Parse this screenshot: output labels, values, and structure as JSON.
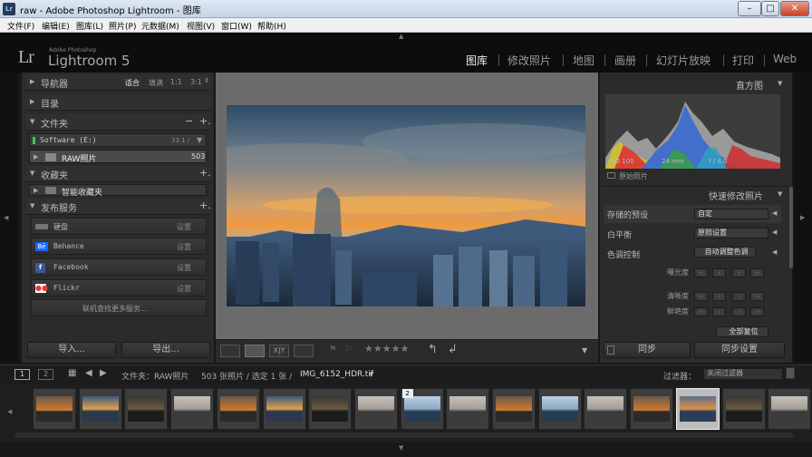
{
  "window": {
    "icon": "Lr",
    "title": "raw - Adobe Photoshop Lightroom - 图库",
    "minimize": "–",
    "maximize": "□",
    "close": "✕"
  },
  "menu": [
    "文件(F)",
    "编辑(E)",
    "图库(L)",
    "照片(P)",
    "元数据(M)",
    "视图(V)",
    "窗口(W)",
    "帮助(H)"
  ],
  "identity": {
    "logo": "Lr",
    "brand_small": "Adobe Photoshop",
    "brand": "Lightroom 5",
    "modules": [
      "图库",
      "修改照片",
      "地图",
      "画册",
      "幻灯片放映",
      "打印",
      "Web"
    ]
  },
  "left_panel": {
    "navigator": {
      "title": "导航器",
      "zoom": [
        "适合",
        "填满",
        "1:1",
        "3:1"
      ]
    },
    "catalog": {
      "title": "目录"
    },
    "folders": {
      "title": "文件夹",
      "volume": "Software (E:)",
      "volume_size": "33.1 / ",
      "folder": "RAW照片",
      "folder_count": "503"
    },
    "collections": {
      "title": "收藏夹",
      "smart": "智能收藏夹"
    },
    "publish": {
      "title": "发布服务",
      "items": [
        {
          "label": "硬盘",
          "setting": "设置"
        },
        {
          "label": "Behance",
          "icon": "Bē",
          "setting": "设置"
        },
        {
          "label": "Facebook",
          "icon": "f",
          "setting": "设置"
        },
        {
          "label": "Flickr",
          "icon": "●●",
          "setting": "设置"
        }
      ],
      "more": "联机查找更多服务..."
    },
    "import": "导入...",
    "export": "导出..."
  },
  "right_panel": {
    "histogram": {
      "title": "直方图",
      "iso": "ISO 100",
      "focal": "24 mm",
      "aperture": "f / 4.0",
      "original": "原始照片"
    },
    "quick_develop": {
      "title": "快速修改照片",
      "saved_preset_label": "存储的预设",
      "saved_preset_value": "自定",
      "wb_label": "白平衡",
      "wb_value": "原照设置",
      "tone_label": "色调控制",
      "auto_tone": "自动调整色调",
      "exposure": "曝光度",
      "clarity": "清晰度",
      "vibrance": "鲜艳度",
      "reset": "全部复位"
    },
    "sync": "同步",
    "sync_settings": "同步设置"
  },
  "toolbar": {
    "stars": "★★★★★"
  },
  "filmstrip_bar": {
    "page1": "1",
    "page2": "2",
    "source": "文件夹：RAW照片",
    "count": "503 张照片 / 选定 1 张 /",
    "filename": "IMG_6152_HDR.tif",
    "filter_label": "过滤器：",
    "filter_value": "关闭过滤器"
  },
  "filmstrip": {
    "badge": "2",
    "thumbs": [
      "dusk",
      "sunset",
      "dark",
      "city",
      "dusk",
      "sunset",
      "dark",
      "city",
      "blue",
      "city",
      "dusk",
      "blue",
      "city",
      "dusk",
      "selected",
      "dark",
      "city"
    ]
  }
}
